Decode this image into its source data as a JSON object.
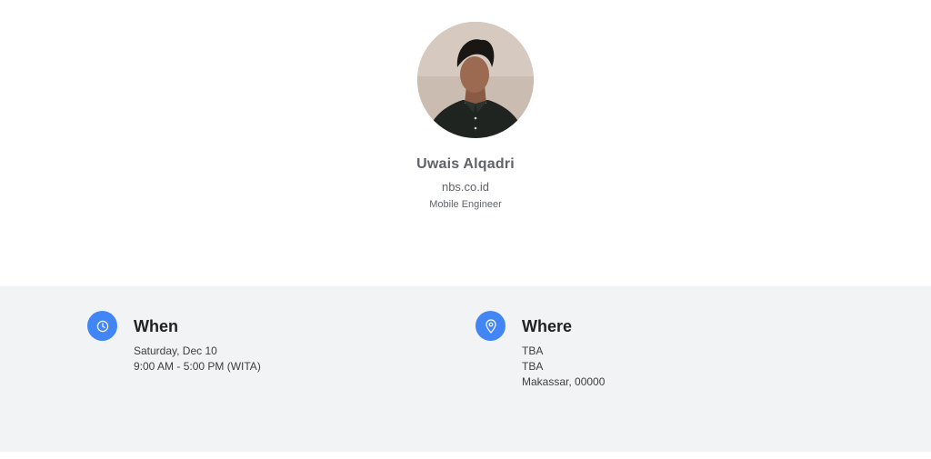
{
  "profile": {
    "name": "Uwais Alqadri",
    "organization": "nbs.co.id",
    "role": "Mobile Engineer"
  },
  "when": {
    "title": "When",
    "date": "Saturday, Dec 10",
    "time": "9:00 AM - 5:00 PM (WITA)",
    "icon": "clock-icon"
  },
  "where": {
    "title": "Where",
    "line1": "TBA",
    "line2": "TBA",
    "line3": "Makassar, 00000",
    "icon": "location-pin-icon"
  },
  "colors": {
    "accent": "#4285f4",
    "section_bg": "#f1f3f4"
  }
}
